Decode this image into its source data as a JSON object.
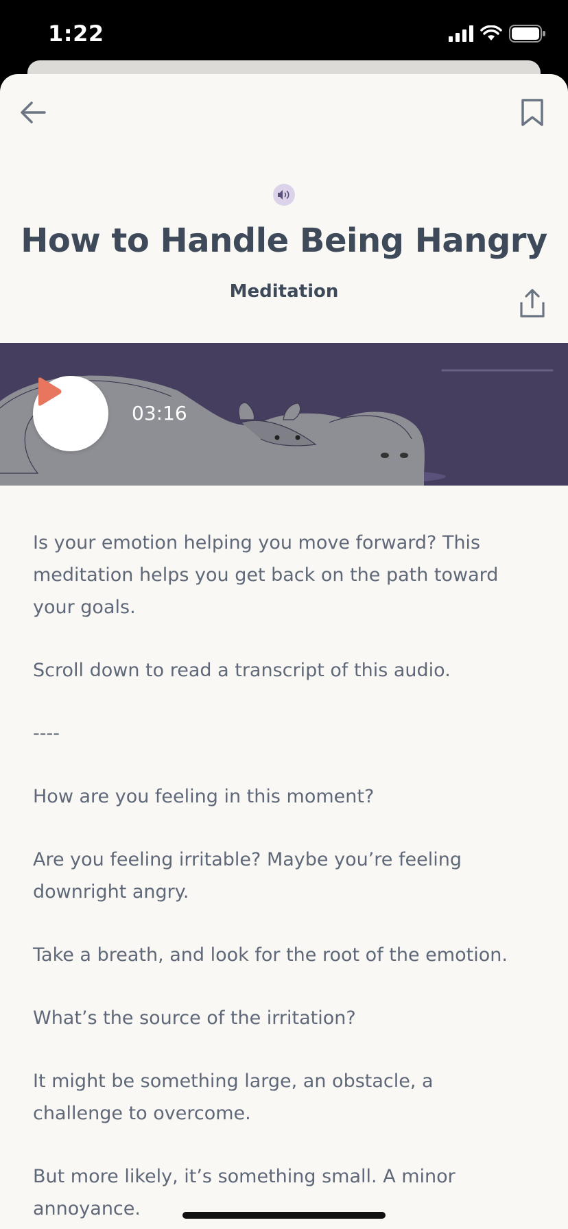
{
  "status": {
    "time": "1:22"
  },
  "header": {
    "back_icon": "arrow-left-icon",
    "bookmark_icon": "bookmark-icon",
    "share_icon": "share-icon",
    "audio_icon": "speaker-icon"
  },
  "title": "How to Handle Being Hangry",
  "category": "Meditation",
  "player": {
    "duration": "03:16",
    "play_icon": "play-icon",
    "accent_color": "#e8755e",
    "hero_bg": "#463e5e"
  },
  "content": {
    "paragraphs": [
      "Is your emotion helping you move forward? This meditation helps you get back on the path toward your goals.",
      "Scroll down to read a transcript of this audio.",
      "----",
      "How are you feeling in this moment?",
      "Are you feeling irritable? Maybe you’re feeling downright angry.",
      "Take a breath, and look for the root of the emotion.",
      "What’s the source of the irritation?",
      "It might be something large, an obstacle, a challenge to overcome.",
      "But more likely, it’s something small. A minor annoyance."
    ]
  }
}
